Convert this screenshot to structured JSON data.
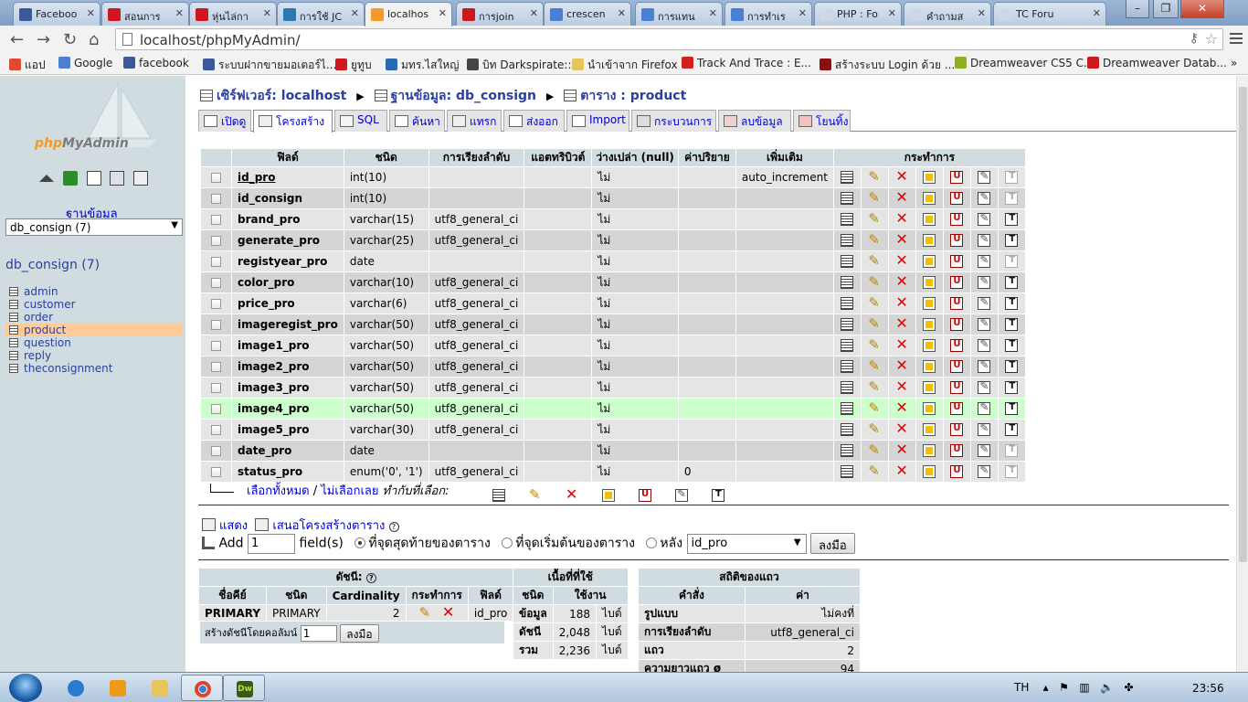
{
  "browser": {
    "tabs": [
      {
        "title": "Faceboo",
        "icon": "facebook-icon",
        "color": "#3b5998"
      },
      {
        "title": "สอนการ",
        "icon": "youtube-icon",
        "color": "#cc181e"
      },
      {
        "title": "หุ่นไล่กา",
        "icon": "youtube-icon",
        "color": "#cc181e"
      },
      {
        "title": "การใช้ JC",
        "icon": "globe-icon",
        "color": "#2a7ab0"
      },
      {
        "title": "localhos",
        "icon": "pma-icon",
        "color": "#f29b2a",
        "active": true
      },
      {
        "title": "การjoin",
        "icon": "youtube-icon",
        "color": "#cc181e"
      },
      {
        "title": "crescen",
        "icon": "google-icon",
        "color": "#4a7fd4"
      },
      {
        "title": "การแทน",
        "icon": "google-icon",
        "color": "#4a7fd4"
      },
      {
        "title": "การทำเร",
        "icon": "google-icon",
        "color": "#4a7fd4"
      },
      {
        "title": "PHP : Fo",
        "icon": "page-icon",
        "color": "#cfd8e4"
      },
      {
        "title": "คำถามส",
        "icon": "page-icon",
        "color": "#cfd8e4"
      },
      {
        "title": "TC Foru",
        "icon": "page-icon",
        "color": "#cfd8e4"
      }
    ],
    "url": "localhost/phpMyAdmin/",
    "bookmarks": [
      {
        "label": "แอป",
        "color": "#e04b2f"
      },
      {
        "label": "Google",
        "color": "#4a7fd4"
      },
      {
        "label": "facebook",
        "color": "#3b5998"
      },
      {
        "label": "ระบบฝากขายมอเตอร์ไ...",
        "color": "#3b5998"
      },
      {
        "label": "ยูทูบ",
        "color": "#cc181e"
      },
      {
        "label": "มทร.ไสใหญ่",
        "color": "#2a6ab0"
      },
      {
        "label": "บิท Darkspirate::",
        "color": "#444444"
      },
      {
        "label": "นำเข้าจาก Firefox",
        "color": "#e8c45c"
      },
      {
        "label": "Track And Trace : E...",
        "color": "#d02020"
      },
      {
        "label": "สร้างระบบ Login ด้วย ...",
        "color": "#8a1010"
      },
      {
        "label": "Dreamweaver CS5 C...",
        "color": "#8fb020"
      },
      {
        "label": "Dreamweaver Datab...",
        "color": "#cc181e"
      }
    ]
  },
  "sidebar": {
    "logo_php": "php",
    "logo_admin": "MyAdmin",
    "db_label": "ฐานข้อมูล",
    "db_selected": "db_consign (7)",
    "db_title": "db_consign (7)",
    "tables": [
      "admin",
      "customer",
      "order",
      "product",
      "question",
      "reply",
      "theconsignment"
    ],
    "active_table": "product"
  },
  "breadcrumb": {
    "server_label": "เซิร์ฟเวอร์: localhost",
    "db_label": "ฐานข้อมูล: db_consign",
    "table_label": "ตาราง : product"
  },
  "tabs": [
    "เปิดดู",
    "โครงสร้าง",
    "SQL",
    "ค้นหา",
    "แทรก",
    "ส่งออก",
    "Import",
    "กระบวนการ",
    "ลบข้อมูล",
    "โยนทิ้ง"
  ],
  "active_tab": "โครงสร้าง",
  "structure": {
    "headers": [
      "ฟิลด์",
      "ชนิด",
      "การเรียงลำดับ",
      "แอตทริบิวต์",
      "ว่างเปล่า (null)",
      "ค่าปริยาย",
      "เพิ่มเติม",
      "กระทำการ"
    ],
    "rows": [
      {
        "field": "id_pro",
        "type": "int(10)",
        "collation": "",
        "attributes": "",
        "null": "ไม่",
        "default": "",
        "extra": "auto_increment",
        "primary": true
      },
      {
        "field": "id_consign",
        "type": "int(10)",
        "collation": "",
        "attributes": "",
        "null": "ไม่",
        "default": "",
        "extra": ""
      },
      {
        "field": "brand_pro",
        "type": "varchar(15)",
        "collation": "utf8_general_ci",
        "attributes": "",
        "null": "ไม่",
        "default": "",
        "extra": ""
      },
      {
        "field": "generate_pro",
        "type": "varchar(25)",
        "collation": "utf8_general_ci",
        "attributes": "",
        "null": "ไม่",
        "default": "",
        "extra": ""
      },
      {
        "field": "registyear_pro",
        "type": "date",
        "collation": "",
        "attributes": "",
        "null": "ไม่",
        "default": "",
        "extra": ""
      },
      {
        "field": "color_pro",
        "type": "varchar(10)",
        "collation": "utf8_general_ci",
        "attributes": "",
        "null": "ไม่",
        "default": "",
        "extra": ""
      },
      {
        "field": "price_pro",
        "type": "varchar(6)",
        "collation": "utf8_general_ci",
        "attributes": "",
        "null": "ไม่",
        "default": "",
        "extra": ""
      },
      {
        "field": "imageregist_pro",
        "type": "varchar(50)",
        "collation": "utf8_general_ci",
        "attributes": "",
        "null": "ไม่",
        "default": "",
        "extra": ""
      },
      {
        "field": "image1_pro",
        "type": "varchar(50)",
        "collation": "utf8_general_ci",
        "attributes": "",
        "null": "ไม่",
        "default": "",
        "extra": ""
      },
      {
        "field": "image2_pro",
        "type": "varchar(50)",
        "collation": "utf8_general_ci",
        "attributes": "",
        "null": "ไม่",
        "default": "",
        "extra": ""
      },
      {
        "field": "image3_pro",
        "type": "varchar(50)",
        "collation": "utf8_general_ci",
        "attributes": "",
        "null": "ไม่",
        "default": "",
        "extra": ""
      },
      {
        "field": "image4_pro",
        "type": "varchar(50)",
        "collation": "utf8_general_ci",
        "attributes": "",
        "null": "ไม่",
        "default": "",
        "extra": "",
        "highlight": true
      },
      {
        "field": "image5_pro",
        "type": "varchar(30)",
        "collation": "utf8_general_ci",
        "attributes": "",
        "null": "ไม่",
        "default": "",
        "extra": ""
      },
      {
        "field": "date_pro",
        "type": "date",
        "collation": "",
        "attributes": "",
        "null": "ไม่",
        "default": "",
        "extra": ""
      },
      {
        "field": "status_pro",
        "type": "enum('0', '1')",
        "collation": "utf8_general_ci",
        "attributes": "",
        "null": "ไม่",
        "default": "0",
        "extra": ""
      }
    ]
  },
  "with_selected": {
    "check_all": "เลือกทั้งหมด",
    "separator": "/",
    "uncheck_all": "ไม่เลือกเลย",
    "label": "ทำกับที่เลือก:"
  },
  "print_row": {
    "print_label": "แสดง",
    "propose_label": "เสนอโครงสร้างตาราง"
  },
  "add_row": {
    "add_label": "Add",
    "count": "1",
    "fields_label": "field(s)",
    "opt_end": "ที่จุดสุดท้ายของตาราง",
    "opt_begin": "ที่จุดเริ่มต้นของตาราง",
    "opt_after": "หลัง",
    "after_field": "id_pro",
    "go": "ลงมือ"
  },
  "indexes": {
    "title": "ดัชนี:",
    "headers": [
      "ชื่อคีย์",
      "ชนิด",
      "Cardinality",
      "กระทำการ",
      "ฟิลด์"
    ],
    "row": {
      "keyname": "PRIMARY",
      "type": "PRIMARY",
      "cardinality": "2",
      "field": "id_pro"
    },
    "create_label": "สร้างดัชนีโดยคอลัมน์",
    "create_count": "1",
    "go": "ลงมือ"
  },
  "space": {
    "title": "เนื้อที่ที่ใช้",
    "headers": [
      "ชนิด",
      "ใช้งาน"
    ],
    "rows": [
      {
        "type": "ข้อมูล",
        "size": "188",
        "unit": "ไบต์"
      },
      {
        "type": "ดัชนี",
        "size": "2,048",
        "unit": "ไบต์"
      },
      {
        "type": "รวม",
        "size": "2,236",
        "unit": "ไบต์"
      }
    ]
  },
  "row_stats": {
    "title": "สถิติของแถว",
    "headers": [
      "คำสั่ง",
      "ค่า"
    ],
    "rows": [
      {
        "stmt": "รูปแบบ",
        "value": "ไม่คงที่"
      },
      {
        "stmt": "การเรียงลำดับ",
        "value": "utf8_general_ci"
      },
      {
        "stmt": "แถว",
        "value": "2"
      },
      {
        "stmt": "ความยาวแถว ø",
        "value": "94"
      }
    ]
  },
  "taskbar": {
    "lang": "TH",
    "clock": "23:56"
  }
}
